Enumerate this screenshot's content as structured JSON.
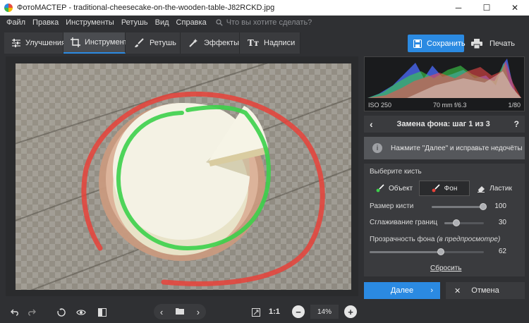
{
  "window": {
    "title": "ФотоМАСТЕР - traditional-cheesecake-on-the-wooden-table-J82RCKD.jpg"
  },
  "menu": {
    "items": [
      "Файл",
      "Правка",
      "Инструменты",
      "Ретушь",
      "Вид",
      "Справка"
    ],
    "search_placeholder": "Что вы хотите сделать?"
  },
  "tabs": [
    {
      "label": "Улучшения",
      "icon": "sliders-icon"
    },
    {
      "label": "Инструменты",
      "icon": "crop-icon",
      "active": true
    },
    {
      "label": "Ретушь",
      "icon": "brush-icon"
    },
    {
      "label": "Эффекты",
      "icon": "magic-wand-icon"
    },
    {
      "label": "Надписи",
      "icon": "text-icon"
    }
  ],
  "toolbar": {
    "save_label": "Сохранить",
    "print_label": "Печать"
  },
  "photo_meta": {
    "iso": "ISO 250",
    "lens": "70 mm f/6.3",
    "shutter": "1/80"
  },
  "panel": {
    "title": "Замена фона: шаг 1 из 3",
    "notice": "Нажмите \"Далее\" и исправьте недочёты",
    "choose_brush_label": "Выберите кисть",
    "brushes": [
      "Объект",
      "Фон",
      "Ластик"
    ],
    "active_brush": "Фон",
    "sliders": {
      "brush_size": {
        "label": "Размер кисти",
        "value": "100",
        "fraction": 1.0
      },
      "edge_smoothing": {
        "label": "Сглаживание границ",
        "value": "30",
        "fraction": 0.3
      },
      "bg_transparency": {
        "label": "Прозрачность фона",
        "label_note": "(в предпросмотре)",
        "value": "62",
        "fraction": 0.62
      }
    },
    "reset_label": "Сбросить",
    "next_label": "Далее",
    "cancel_label": "Отмена"
  },
  "bottom": {
    "zoom_ratio": "1:1",
    "zoom_value": "14%"
  },
  "colors": {
    "accent": "#2b8ae2",
    "object_brush": "#3cd04a",
    "background_brush": "#e8423a"
  }
}
